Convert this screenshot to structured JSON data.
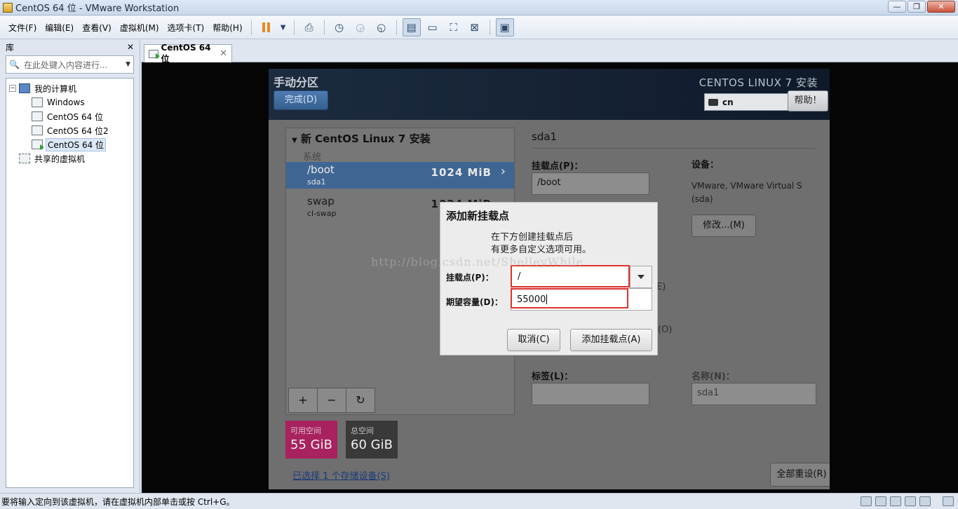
{
  "window": {
    "title": "CentOS 64 位 - VMware Workstation",
    "min": "—",
    "max": "❐",
    "close": "✕"
  },
  "menu": [
    "文件(F)",
    "编辑(E)",
    "查看(V)",
    "虚拟机(M)",
    "选项卡(T)",
    "帮助(H)"
  ],
  "library": {
    "title": "库",
    "close": "✕",
    "search_placeholder": "在此处键入内容进行...",
    "tree": [
      {
        "label": "我的计算机"
      },
      {
        "label": "Windows"
      },
      {
        "label": "CentOS 64 位"
      },
      {
        "label": "CentOS 64 位2"
      },
      {
        "label": "CentOS 64 位"
      },
      {
        "label": "共享的虚拟机"
      }
    ]
  },
  "tab": {
    "label": "CentOS 64 位",
    "close": "✕"
  },
  "installer": {
    "title": "手动分区",
    "done_button": "完成(D)",
    "brand": "CENTOS LINUX 7 安装",
    "keyboard": "cn",
    "help_button": "帮助！",
    "install_section": "新 CentOS Linux 7 安装",
    "group": "系统",
    "mounts": [
      {
        "name": "/boot",
        "device": "sda1",
        "size": "1024 MiB"
      },
      {
        "name": "swap",
        "device": "cl-swap",
        "size": "1024 MiB"
      }
    ],
    "add": "+",
    "remove": "−",
    "refresh": "↻",
    "available": {
      "label": "可用空间",
      "value": "55 GiB"
    },
    "total": {
      "label": "总空间",
      "value": "60 GiB"
    },
    "storage_link": "已选择 1 个存储设备(S)",
    "reset_button": "全部重设(R)",
    "detail": {
      "title": "sda1",
      "mount_label": "挂载点(P)：",
      "mount_value": "/boot",
      "device_label": "设备：",
      "device_value": "VMware, VMware Virtual S (sda)",
      "modify_button": "修改...(M)",
      "label_label": "标签(L)：",
      "label_value": "",
      "name_label": "名称(N)：",
      "name_value": "sda1",
      "ghost_e": "E)",
      "ghost_o": "(O)"
    }
  },
  "dialog": {
    "title": "添加新挂载点",
    "desc_line1": "在下方创建挂载点后",
    "desc_line2": "有更多自定义选项可用。",
    "mount_label": "挂载点(P)：",
    "mount_value": "/",
    "capacity_label": "期望容量(D)：",
    "capacity_value": "55000",
    "cancel_button": "取消(C)",
    "add_button": "添加挂载点(A)"
  },
  "watermark": "http://blog.csdn.net/ShelleyWhile",
  "status": "要将输入定向到该虚拟机，请在虚拟机内部单击或按 Ctrl+G。"
}
